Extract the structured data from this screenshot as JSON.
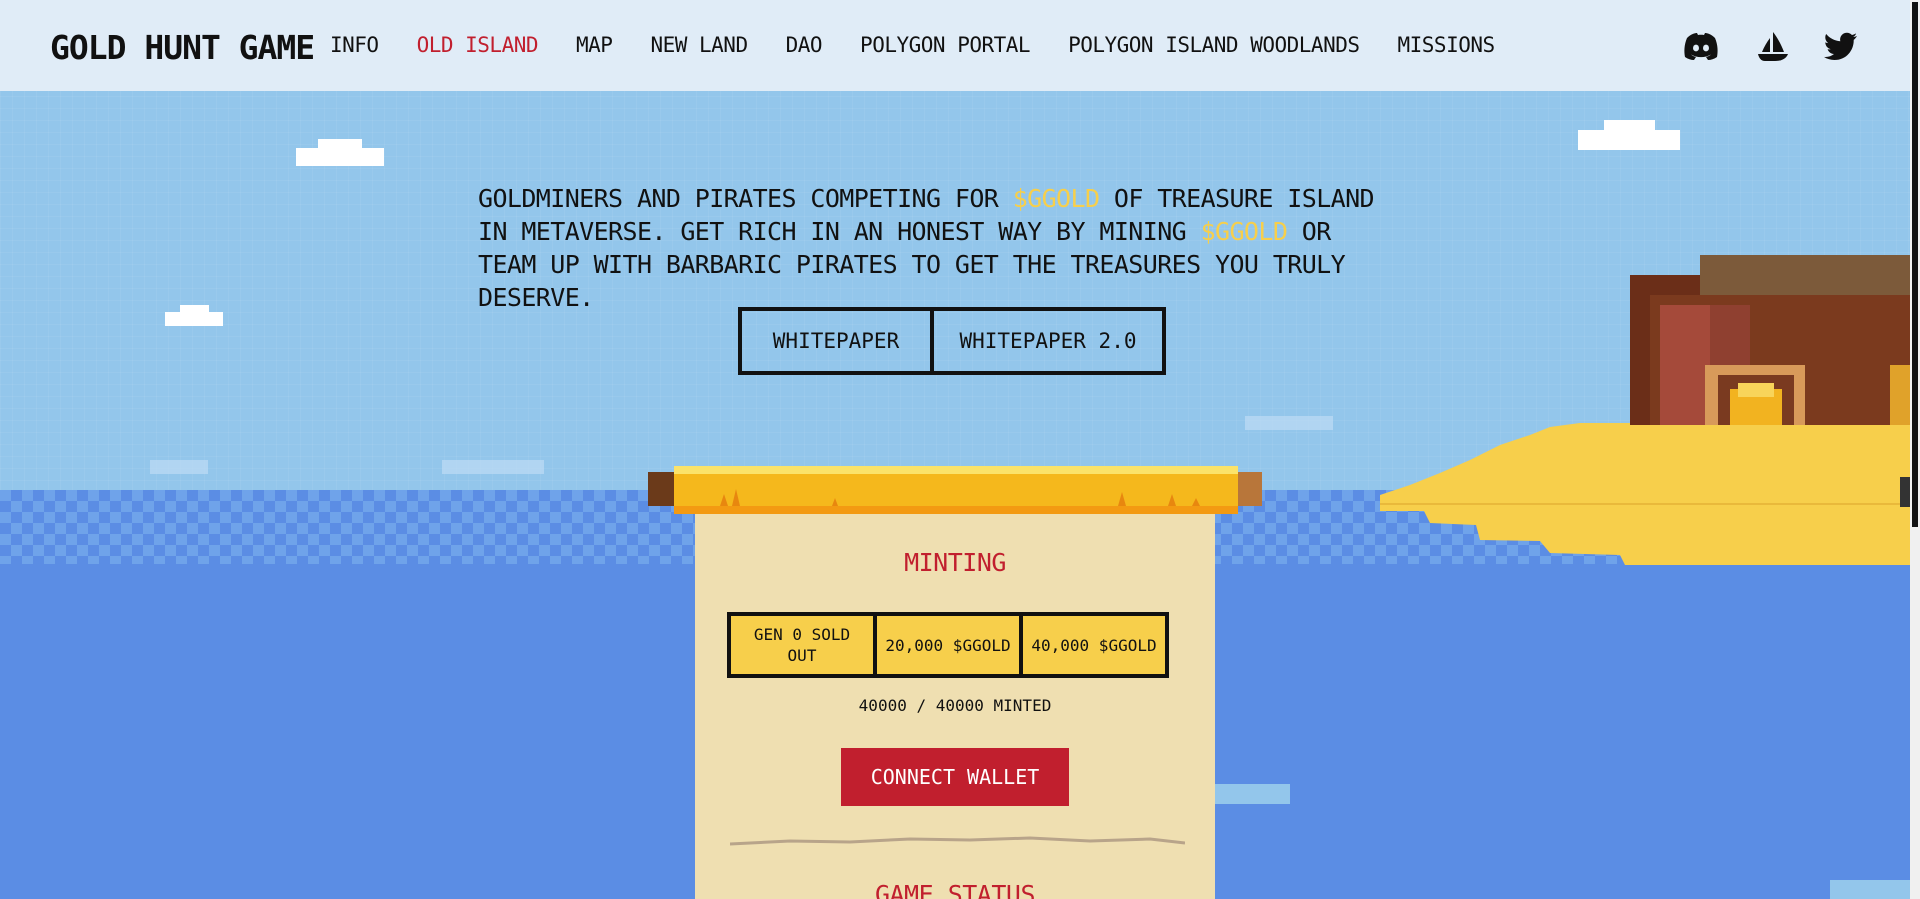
{
  "header": {
    "logo": "GOLD HUNT GAME",
    "nav": [
      {
        "label": "INFO",
        "active": false
      },
      {
        "label": "OLD ISLAND",
        "active": true
      },
      {
        "label": "MAP",
        "active": false
      },
      {
        "label": "NEW LAND",
        "active": false
      },
      {
        "label": "DAO",
        "active": false
      },
      {
        "label": "POLYGON PORTAL",
        "active": false
      },
      {
        "label": "POLYGON ISLAND WOODLANDS",
        "active": false
      },
      {
        "label": "MISSIONS",
        "active": false
      }
    ],
    "social": [
      "discord-icon",
      "opensea-icon",
      "twitter-icon"
    ]
  },
  "hero": {
    "line1_a": "GOLDMINERS AND PIRATES COMPETING FOR ",
    "gold1": "$GGOLD",
    "line1_b": " OF TREASURE ISLAND IN METAVERSE. GET RICH IN AN HONEST WAY BY MINING ",
    "gold2": "$GGOLD",
    "line1_c": " OR TEAM UP WITH BARBARIC PIRATES TO GET THE TREASURES YOU TRULY DESERVE.",
    "whitepaper": "WHITEPAPER",
    "whitepaper2": "WHITEPAPER 2.0"
  },
  "minting": {
    "title": "MINTING",
    "gens": [
      "GEN 0 SOLD OUT",
      "20,000 $GGOLD",
      "40,000 $GGOLD"
    ],
    "minted": "40000 / 40000 MINTED",
    "connect": "CONNECT WALLET",
    "game_status": "GAME STATUS"
  },
  "colors": {
    "accent_red": "#c11f2e",
    "gold": "#f7cf4b",
    "paper": "#efdfb1",
    "sky": "#93c6eb",
    "sea": "#5b8de4"
  }
}
